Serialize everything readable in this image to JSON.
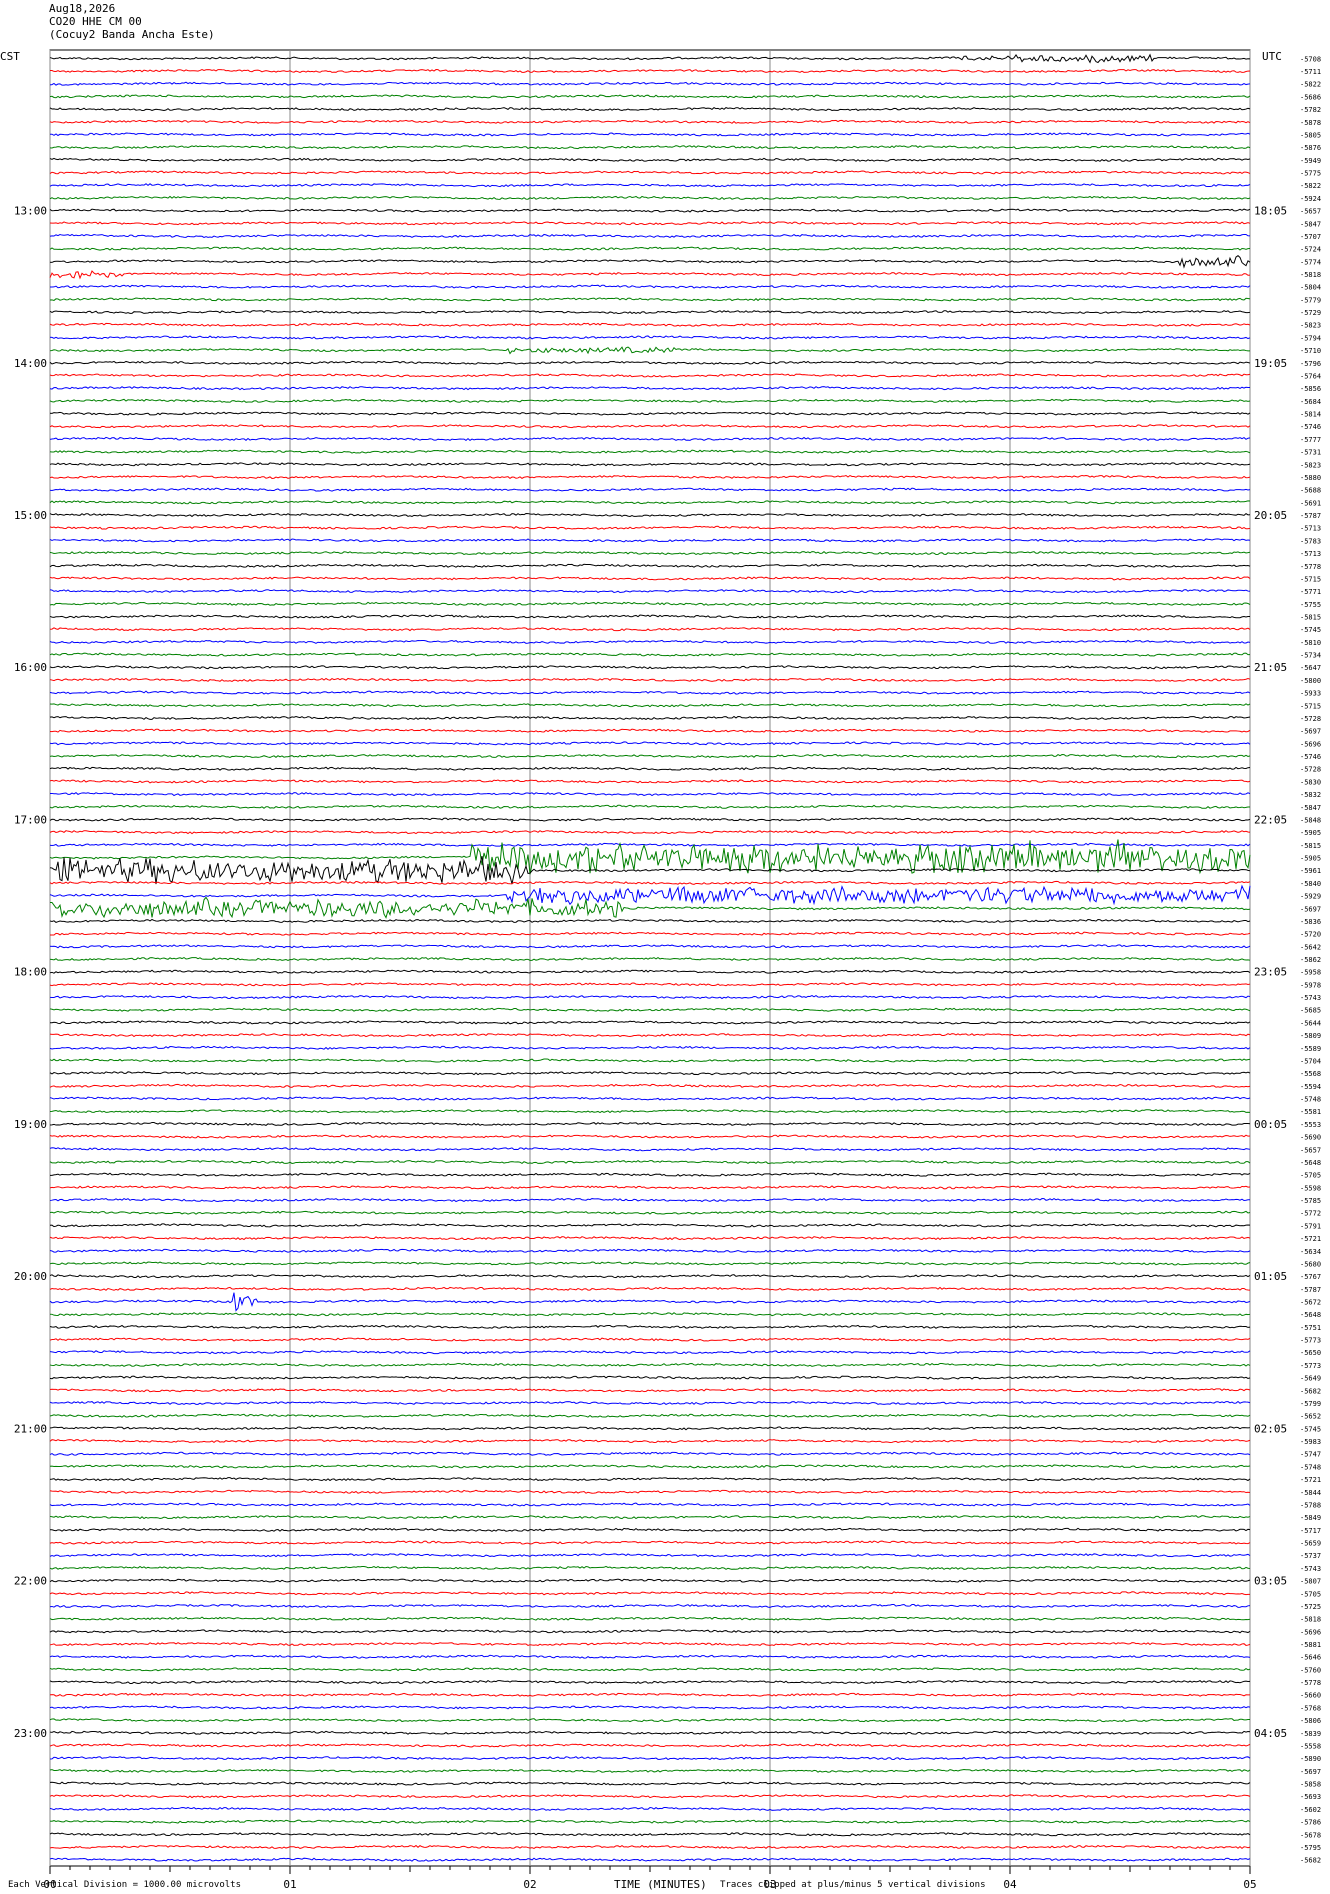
{
  "header": {
    "date": "Aug18,2026",
    "station": "CO20 HHE CM 00",
    "site": "(Cocuy2 Banda Ancha Este)"
  },
  "labels": {
    "left_tz": "CST",
    "right_tz": "UTC"
  },
  "footer": {
    "scale": "Each Vertical Division = 1000.00 microvolts",
    "xlabel": "TIME (MINUTES)",
    "clip": "Traces clipped at plus/minus 5 vertical divisions"
  },
  "chart_data": {
    "type": "line",
    "trace_colors": [
      "#000000",
      "#ff0000",
      "#0000ff",
      "#008000"
    ],
    "x_ticks": [
      "00",
      "01",
      "02",
      "03",
      "04",
      "05"
    ],
    "xlim": [
      0,
      5
    ],
    "left_times": [
      "13:00",
      "14:00",
      "15:00",
      "16:00",
      "17:00",
      "18:00",
      "19:00",
      "20:00",
      "21:00",
      "22:00",
      "23:00"
    ],
    "right_times": [
      "18:05",
      "19:05",
      "20:05",
      "21:05",
      "22:05",
      "23:05",
      "00:05",
      "01:05",
      "02:05",
      "03:05",
      "04:05"
    ],
    "first_label_row": 12,
    "rows_per_hour": 12,
    "trace_means": [
      -5708,
      -5711,
      -5822,
      -5686,
      -5782,
      -5878,
      -5805,
      -5876,
      -5949,
      -5775,
      -5822,
      -5924,
      -5657,
      -5847,
      -5707,
      -5724,
      -5774,
      -5818,
      -5804,
      -5779,
      -5729,
      -5823,
      -5794,
      -5710,
      -5796,
      -5764,
      -5856,
      -5684,
      -5814,
      -5746,
      -5777,
      -5731,
      -5823,
      -5880,
      -5688,
      -5691,
      -5787,
      -5713,
      -5783,
      -5713,
      -5778,
      -5715,
      -5771,
      -5755,
      -5815,
      -5745,
      -5810,
      -5734,
      -5647,
      -5800,
      -5933,
      -5715,
      -5728,
      -5697,
      -5696,
      -5746,
      -5728,
      -5830,
      -5832,
      -5847,
      -5848,
      -5905,
      -5815,
      -5905,
      -5961,
      -5840,
      -5929,
      -5697,
      -5836,
      -5720,
      -5642,
      -5862,
      -5958,
      -5978,
      -5743,
      -5685,
      -5644,
      -5809,
      -5589,
      -5704,
      -5568,
      -5594,
      -5748,
      -5581,
      -5553,
      -5690,
      -5657,
      -5648,
      -5705,
      -5598,
      -5785,
      -5772,
      -5791,
      -5721,
      -5634,
      -5680,
      -5767,
      -5787,
      -5672,
      -5648,
      -5751,
      -5773,
      -5650,
      -5773,
      -5649,
      -5682,
      -5799,
      -5652,
      -5745,
      -5983,
      -5747,
      -5748,
      -5721,
      -5844,
      -5788,
      -5849,
      -5717,
      -5659,
      -5737,
      -5743,
      -5807,
      -5705,
      -5725,
      -5818,
      -5696,
      -5881,
      -5646,
      -5760,
      -5778,
      -5660,
      -5768,
      -5806,
      -5839,
      -5558,
      -5890,
      -5697,
      -5858,
      -5693,
      -5602,
      -5786,
      -5678,
      -5795,
      -5682
    ],
    "events": [
      {
        "row": 0,
        "start": 3.8,
        "end": 4.6,
        "amp": 3
      },
      {
        "row": 16,
        "start": 4.7,
        "end": 5.0,
        "amp": 4
      },
      {
        "row": 17,
        "start": 0.0,
        "end": 0.3,
        "amp": 3
      },
      {
        "row": 23,
        "start": 1.9,
        "end": 2.6,
        "amp": 2.5
      },
      {
        "row": 63,
        "start": 1.75,
        "end": 5.0,
        "amp": 12
      },
      {
        "row": 64,
        "start": 0.0,
        "end": 2.0,
        "amp": 10
      },
      {
        "row": 66,
        "start": 1.9,
        "end": 5.0,
        "amp": 7
      },
      {
        "row": 67,
        "start": 0.0,
        "end": 2.4,
        "amp": 7
      },
      {
        "row": 98,
        "start": 0.76,
        "end": 1.0,
        "amp": 24
      }
    ]
  }
}
